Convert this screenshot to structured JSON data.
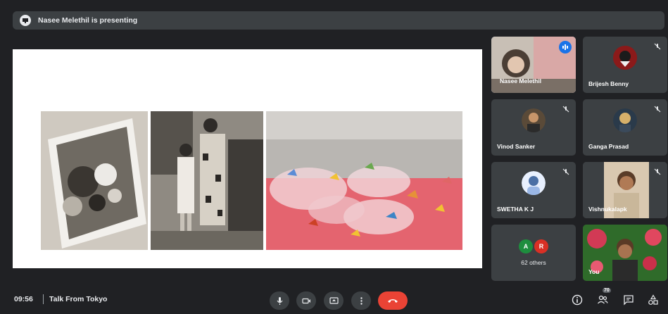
{
  "presenting_bar": {
    "text": "Nasee Melethil is presenting"
  },
  "participants": [
    {
      "name": "Nasee Melethil",
      "speaking": true
    },
    {
      "name": "Brijesh Benny",
      "muted": true
    },
    {
      "name": "Vinod Sanker",
      "muted": true
    },
    {
      "name": "Ganga Prasad",
      "muted": true
    },
    {
      "name": "SWETHA K J",
      "muted": true
    },
    {
      "name": "Vishnukalapk",
      "muted": true
    },
    {
      "name": "You"
    }
  ],
  "others": {
    "chips": [
      "A",
      "R"
    ],
    "label": "62 others"
  },
  "footer": {
    "time": "09:56",
    "meeting_title": "Talk From Tokyo",
    "people_count": "70"
  },
  "colors": {
    "background": "#202124",
    "tile": "#3c4043",
    "end_call": "#ea4335",
    "speaking_accent": "#1a73e8",
    "chip_a": "#1e8e3e",
    "chip_r": "#d93025"
  },
  "icons": [
    "presentation-icon",
    "mic-icon",
    "camera-icon",
    "present-screen-icon",
    "more-options-icon",
    "end-call-icon",
    "info-icon",
    "people-icon",
    "chat-icon",
    "activities-icon",
    "mic-off-icon",
    "speaking-icon"
  ]
}
